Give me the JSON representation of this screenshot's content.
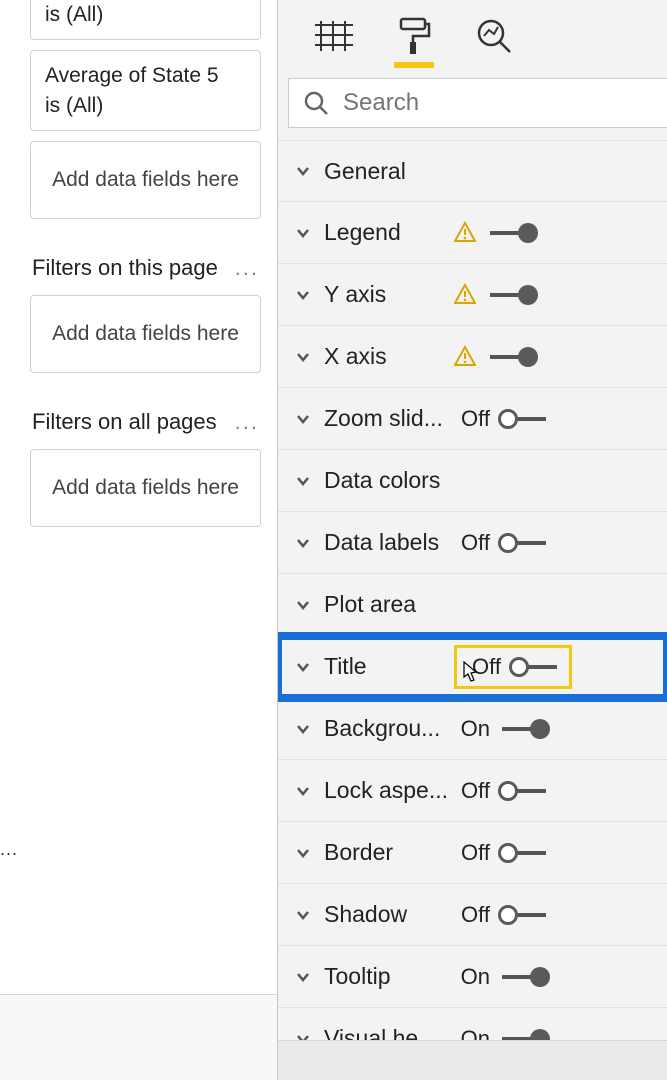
{
  "filters": {
    "cards": [
      {
        "line1": "",
        "line2": "is (All)"
      },
      {
        "line1": "Average of State 5",
        "line2": "is (All)"
      }
    ],
    "dropzone_label": "Add data fields here",
    "sections": [
      {
        "title": "Filters on this page",
        "more": "..."
      },
      {
        "title": "Filters on all pages",
        "more": "..."
      }
    ],
    "left_footer_dots": "..."
  },
  "search": {
    "placeholder": "Search"
  },
  "properties": [
    {
      "label": "General",
      "warning": false,
      "state": null,
      "on": null
    },
    {
      "label": "Legend",
      "warning": true,
      "state": null,
      "on": true
    },
    {
      "label": "Y axis",
      "warning": true,
      "state": null,
      "on": true
    },
    {
      "label": "X axis",
      "warning": true,
      "state": null,
      "on": true
    },
    {
      "label": "Zoom slid...",
      "warning": false,
      "state": "Off",
      "on": false
    },
    {
      "label": "Data colors",
      "warning": false,
      "state": null,
      "on": null
    },
    {
      "label": "Data labels",
      "warning": false,
      "state": "Off",
      "on": false
    },
    {
      "label": "Plot area",
      "warning": false,
      "state": null,
      "on": null
    },
    {
      "label": "Title",
      "warning": false,
      "state": "Off",
      "on": false,
      "highlight": true
    },
    {
      "label": "Backgrou...",
      "warning": false,
      "state": "On",
      "on": true
    },
    {
      "label": "Lock aspe...",
      "warning": false,
      "state": "Off",
      "on": false
    },
    {
      "label": "Border",
      "warning": false,
      "state": "Off",
      "on": false
    },
    {
      "label": "Shadow",
      "warning": false,
      "state": "Off",
      "on": false
    },
    {
      "label": "Tooltip",
      "warning": false,
      "state": "On",
      "on": true
    },
    {
      "label": "Visual he...",
      "warning": false,
      "state": "On",
      "on": true
    }
  ]
}
